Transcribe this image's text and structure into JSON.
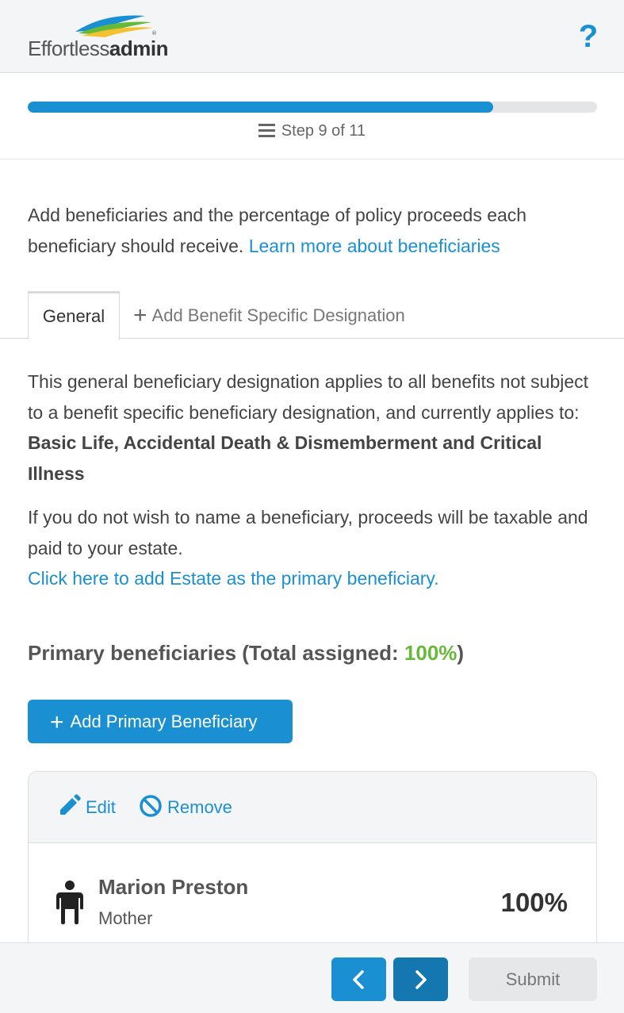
{
  "header": {
    "logo_light": "Effortless",
    "logo_bold": "admin",
    "help_icon": "question-mark-icon",
    "help_label": "?"
  },
  "progress": {
    "current_step": 9,
    "total_steps": 11,
    "fraction": 0.818,
    "label": "Step 9 of 11",
    "icon": "menu-icon"
  },
  "intro": {
    "text": "Add beneficiaries and the percentage of policy proceeds each beneficiary should receive.",
    "link": "Learn more about beneficiaries"
  },
  "tabs": {
    "general": "General",
    "add_specific": "Add Benefit Specific Designation",
    "add_icon": "plus-icon"
  },
  "description": {
    "text": "This general beneficiary designation applies to all benefits not subject to a benefit specific beneficiary designation, and currently applies to:",
    "benefits": "Basic Life, Accidental Death & Dismemberment and Critical Illness",
    "estate_text": "If you do not wish to name a beneficiary, proceeds will be taxable and paid to your estate.",
    "estate_link": "Click here to add Estate as the primary beneficiary."
  },
  "primary": {
    "heading_prefix": "Primary beneficiaries (Total assigned: ",
    "total_assigned": "100%",
    "heading_suffix": ")",
    "add_button": "Add Primary Beneficiary"
  },
  "beneficiary": {
    "edit_label": "Edit",
    "remove_label": "Remove",
    "edit_icon": "pencil-icon",
    "remove_icon": "ban-icon",
    "person_icon": "person-icon",
    "name": "Marion Preston",
    "relationship": "Mother",
    "percentage": "100%"
  },
  "footer": {
    "prev_icon": "chevron-left-icon",
    "next_icon": "chevron-right-icon",
    "submit_label": "Submit"
  },
  "colors": {
    "accent": "#1a90d2",
    "accent_dark": "#1477b0",
    "success": "#67b93a",
    "text": "#444444"
  }
}
